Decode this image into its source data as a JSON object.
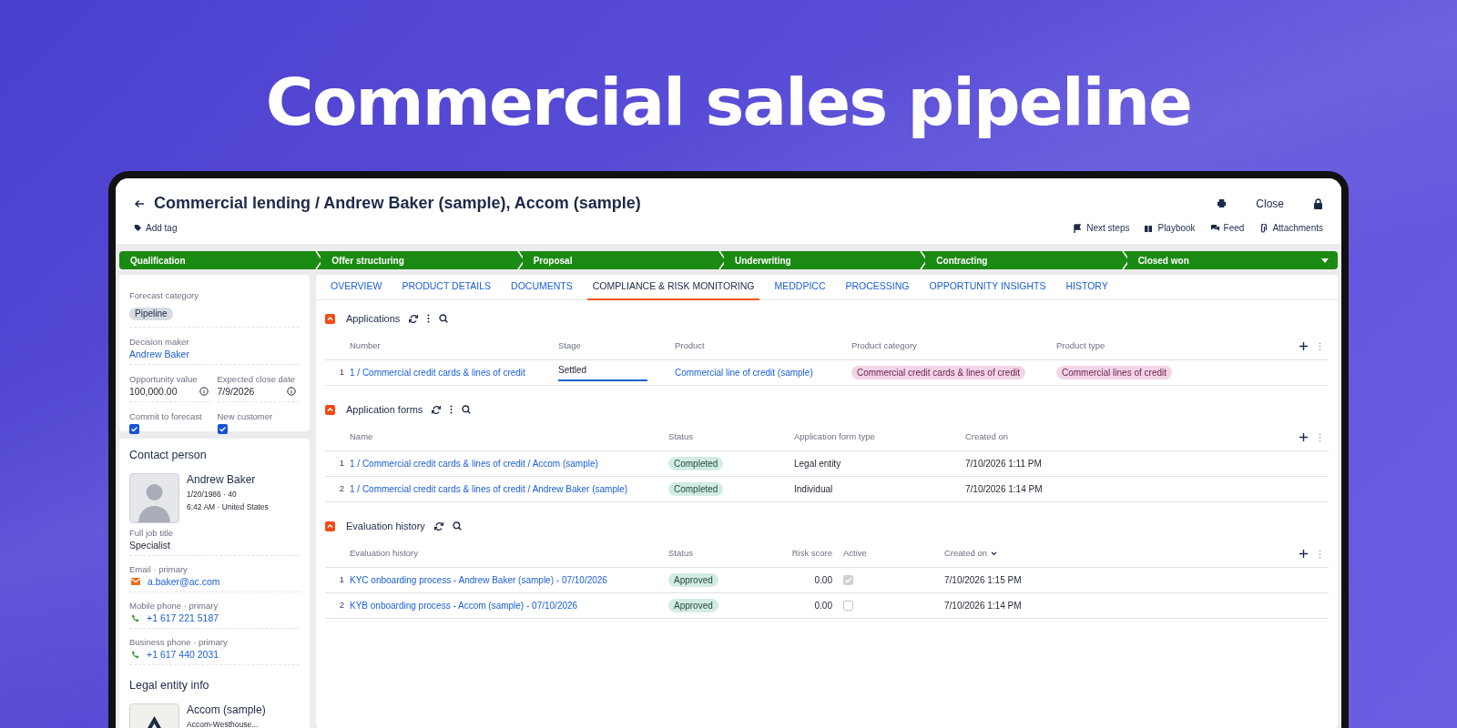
{
  "banner": {
    "title": "Commercial sales pipeline"
  },
  "header": {
    "title": "Commercial lending / Andrew Baker (sample), Accom (sample)",
    "add_tag": "Add tag",
    "close": "Close",
    "actions": [
      {
        "kind": "flag",
        "label": "Next steps"
      },
      {
        "kind": "book",
        "label": "Playbook"
      },
      {
        "kind": "feed",
        "label": "Feed"
      },
      {
        "kind": "clip",
        "label": "Attachments"
      }
    ]
  },
  "stages": [
    {
      "label": "Qualification"
    },
    {
      "label": "Offer structuring"
    },
    {
      "label": "Proposal"
    },
    {
      "label": "Underwriting"
    },
    {
      "label": "Contracting"
    },
    {
      "label": "Closed won"
    }
  ],
  "summary": {
    "forecast_category": {
      "label": "Forecast category",
      "value": "Pipeline"
    },
    "decision_maker": {
      "label": "Decision maker",
      "value": "Andrew Baker"
    },
    "opportunity_value": {
      "label": "Opportunity value",
      "value": "100,000.00"
    },
    "close_date": {
      "label": "Expected close date",
      "value": "7/9/2026"
    },
    "commit": {
      "label": "Commit to forecast",
      "checked": true
    },
    "new_customer": {
      "label": "New customer",
      "checked": true
    }
  },
  "contact": {
    "title": "Contact person",
    "name": "Andrew Baker",
    "birth": "1/20/1986 · 40",
    "local_time": "6:42 AM · United States",
    "fields": [
      {
        "kind": "text",
        "label": "Full job title",
        "value": "Specialist"
      },
      {
        "kind": "email",
        "label": "Email · primary",
        "value": "a.baker@ac.com"
      },
      {
        "kind": "phone",
        "label": "Mobile phone · primary",
        "value": "+1 617 221 5187"
      },
      {
        "kind": "phone",
        "label": "Business phone · primary",
        "value": "+1 617 440 2031"
      }
    ]
  },
  "legal_entity": {
    "title": "Legal entity info",
    "name": "Accom (sample)",
    "address": "Accom-Westhouse..."
  },
  "tabs": [
    {
      "label": "OVERVIEW",
      "selected": false
    },
    {
      "label": "PRODUCT DETAILS",
      "selected": false
    },
    {
      "label": "DOCUMENTS",
      "selected": false
    },
    {
      "label": "COMPLIANCE & RISK MONITORING",
      "selected": true
    },
    {
      "label": "MEDDPICC",
      "selected": false
    },
    {
      "label": "PROCESSING",
      "selected": false
    },
    {
      "label": "OPPORTUNITY INSIGHTS",
      "selected": false
    },
    {
      "label": "HISTORY",
      "selected": false
    }
  ],
  "sections": [
    {
      "title": "Applications",
      "menu": true,
      "columns": [
        {
          "label": "Number"
        },
        {
          "label": "Stage"
        },
        {
          "label": "Product"
        },
        {
          "label": "Product category"
        },
        {
          "label": "Product type"
        }
      ],
      "rows": [
        {
          "index": "1",
          "cells": [
            {
              "kind": "link",
              "text": "1 / Commercial credit cards & lines of credit"
            },
            {
              "kind": "stage",
              "text": "Settled"
            },
            {
              "kind": "link",
              "text": "Commercial line of credit (sample)"
            },
            {
              "kind": "tag",
              "text": "Commercial credit cards & lines of credit",
              "color": "#f3d5e6"
            },
            {
              "kind": "tag",
              "text": "Commercial lines of credit",
              "color": "#f3d5e6"
            }
          ]
        }
      ]
    },
    {
      "title": "Application forms",
      "menu": true,
      "columns": [
        {
          "label": "Name"
        },
        {
          "label": "Status"
        },
        {
          "label": "Application form type"
        },
        {
          "label": "Created on"
        }
      ],
      "rows": [
        {
          "index": "1",
          "cells": [
            {
              "kind": "link",
              "text": "1 / Commercial credit cards & lines of credit / Accom (sample)"
            },
            {
              "kind": "status",
              "text": "Completed"
            },
            {
              "kind": "text",
              "text": "Legal entity"
            },
            {
              "kind": "text",
              "text": "7/10/2026 1:11 PM"
            }
          ]
        },
        {
          "index": "2",
          "cells": [
            {
              "kind": "link",
              "text": "1 / Commercial credit cards & lines of credit / Andrew Baker (sample)"
            },
            {
              "kind": "status",
              "text": "Completed"
            },
            {
              "kind": "text",
              "text": "Individual"
            },
            {
              "kind": "text",
              "text": "7/10/2026 1:14 PM"
            }
          ]
        }
      ]
    },
    {
      "title": "Evaluation history",
      "menu": false,
      "columns": [
        {
          "label": "Evaluation history"
        },
        {
          "label": "Status"
        },
        {
          "label": "Risk score"
        },
        {
          "label": "Active"
        },
        {
          "label": "Created on",
          "sorted": true
        }
      ],
      "rows": [
        {
          "index": "1",
          "cells": [
            {
              "kind": "link",
              "text": "KYC onboarding process - Andrew Baker (sample) - 07/10/2026"
            },
            {
              "kind": "status",
              "text": "Approved"
            },
            {
              "kind": "number",
              "text": "0.00"
            },
            {
              "kind": "checkbox",
              "checked": true
            },
            {
              "kind": "text",
              "text": "7/10/2026 1:15 PM"
            }
          ]
        },
        {
          "index": "2",
          "cells": [
            {
              "kind": "link",
              "text": "KYB onboarding process - Accom (sample) - 07/10/2026"
            },
            {
              "kind": "status",
              "text": "Approved"
            },
            {
              "kind": "number",
              "text": "0.00"
            },
            {
              "kind": "checkbox",
              "checked": false
            },
            {
              "kind": "text",
              "text": "7/10/2026 1:14 PM"
            }
          ]
        }
      ]
    }
  ]
}
